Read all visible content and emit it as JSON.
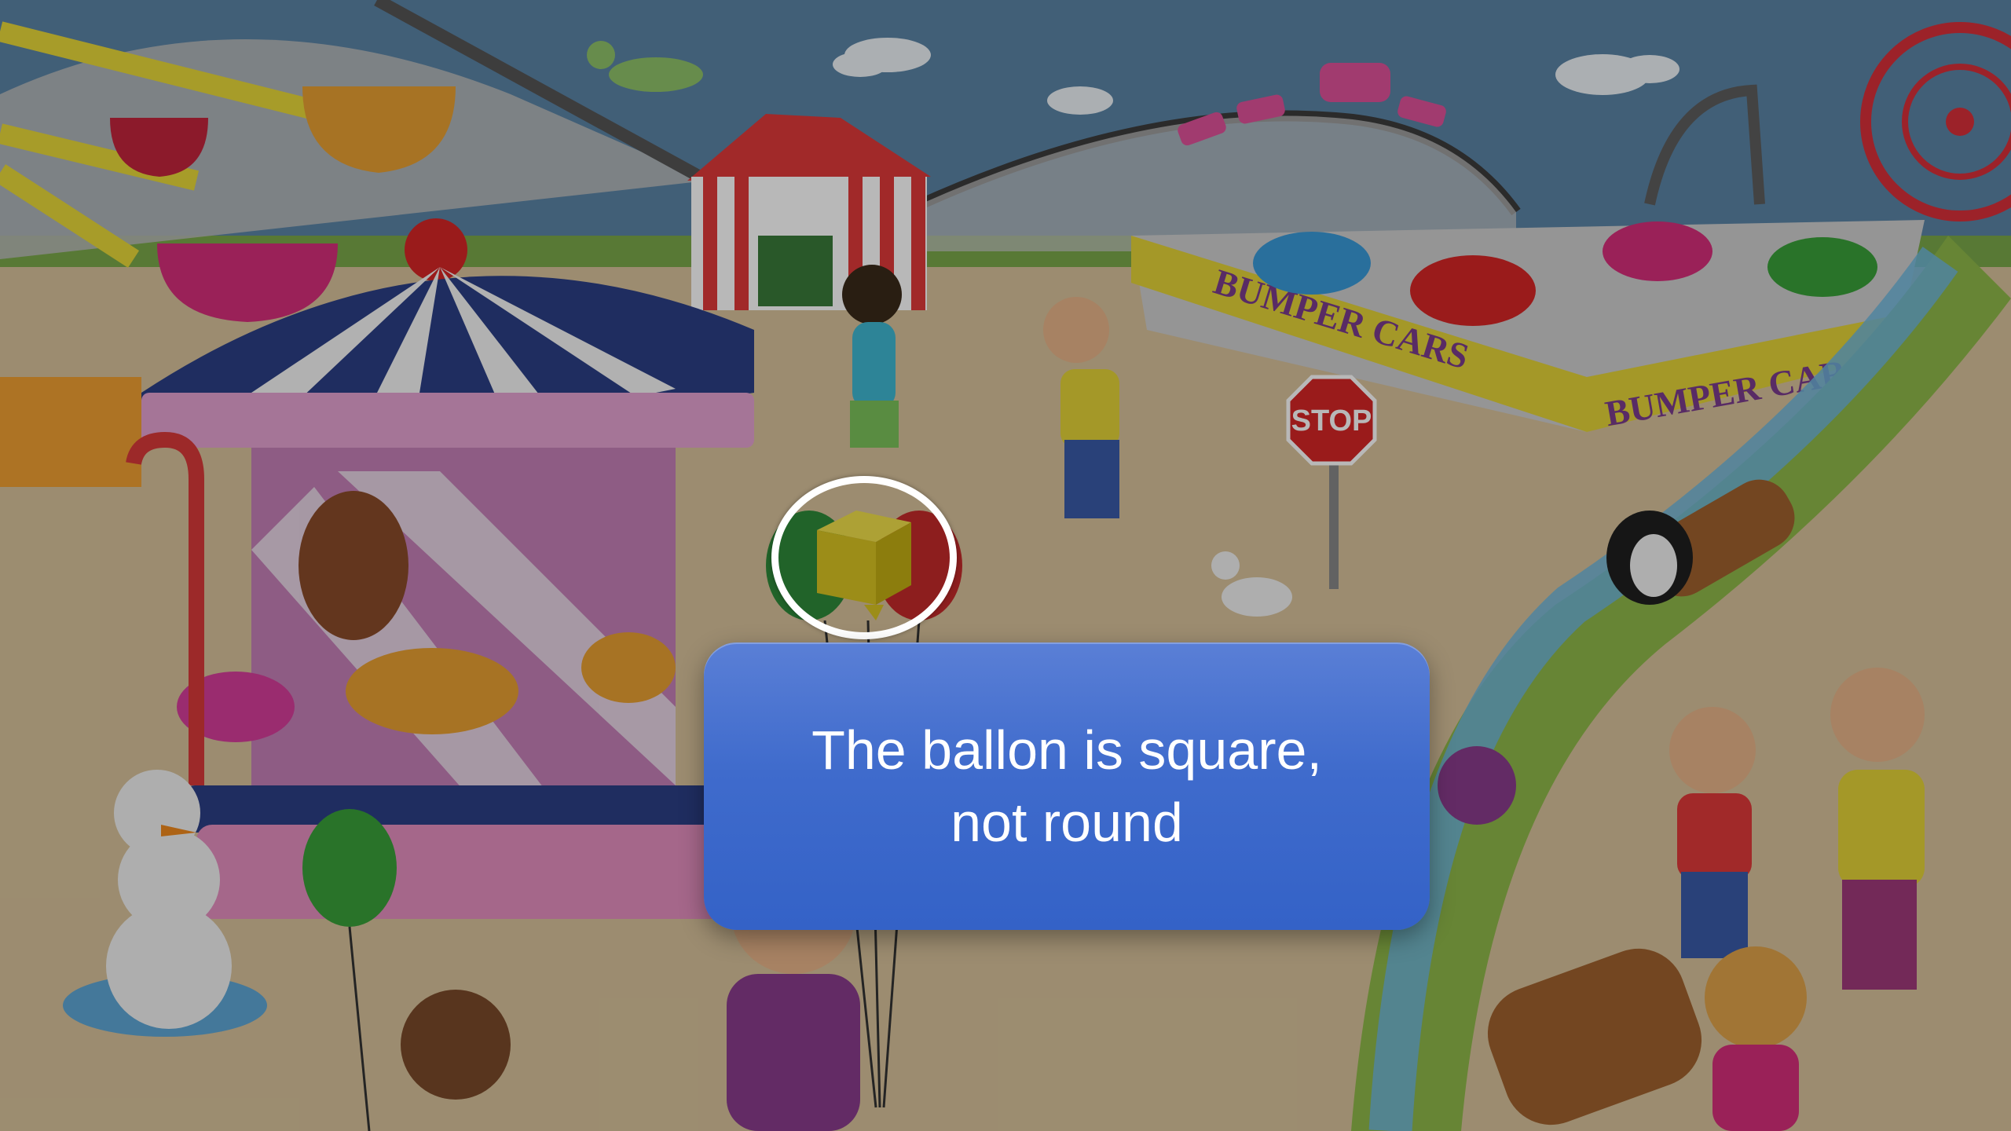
{
  "scene": {
    "signs": {
      "bumper_cars_left": "BUMPER CARS",
      "bumper_cars_right": "BUMPER CARS",
      "stop": "STOP"
    }
  },
  "hint": {
    "line1": "The ballon is square,",
    "line2": "not round"
  },
  "colors": {
    "sky": "#5b84a6",
    "ground": "#d8c39b",
    "hint_panel": "#3f6bcc",
    "highlight_ring": "#ffffff"
  }
}
